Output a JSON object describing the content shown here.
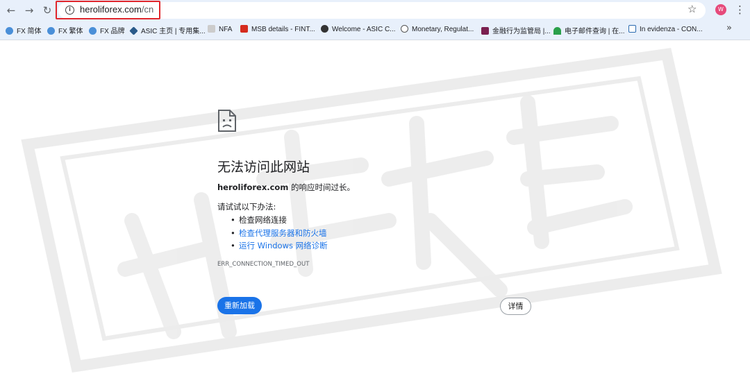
{
  "browser": {
    "url_host": "heroliforex.com",
    "url_path": "/cn",
    "profile_initial": "W",
    "bookmarks": [
      {
        "label": "FX 简体",
        "icon": "fx-icon",
        "color": "#4a8fd8"
      },
      {
        "label": "FX 繁体",
        "icon": "fx-icon",
        "color": "#4a8fd8"
      },
      {
        "label": "FX 品牌",
        "icon": "fx-icon",
        "color": "#4a8fd8"
      },
      {
        "label": "ASIC 主页 | 专用集...",
        "icon": "asic-icon",
        "color": "#2a5a8a"
      },
      {
        "label": "NFA",
        "icon": "nfa-icon",
        "color": "#cccccc"
      },
      {
        "label": "MSB details - FINT...",
        "icon": "maple-leaf-icon",
        "color": "#d52b1e"
      },
      {
        "label": "Welcome - ASIC C...",
        "icon": "globe-icon",
        "color": "#333333"
      },
      {
        "label": "Monetary, Regulat...",
        "icon": "mas-icon",
        "color": "#555555"
      },
      {
        "label": "金融行为监管局 |...",
        "icon": "fca-icon",
        "color": "#7a1f4f"
      },
      {
        "label": "电子邮件查询 | 在...",
        "icon": "wifi-icon",
        "color": "#2aa04a"
      },
      {
        "label": "In evidenza - CON...",
        "icon": "consob-icon",
        "color": "#2a6ab0"
      }
    ]
  },
  "error": {
    "title": "无法访问此网站",
    "host": "heroliforex.com",
    "desc_suffix": " 的响应时间过长。",
    "try_label": "请试试以下办法:",
    "suggestions": [
      "检查网络连接",
      "检查代理服务器和防火墙",
      "运行 Windows 网络诊断"
    ],
    "code": "ERR_CONNECTION_TIMED_OUT",
    "reload_label": "重新加载",
    "details_label": "详情"
  },
  "colors": {
    "accent": "#1a73e8",
    "highlight": "#e0262c",
    "chrome_bg": "#e8f0fb"
  }
}
